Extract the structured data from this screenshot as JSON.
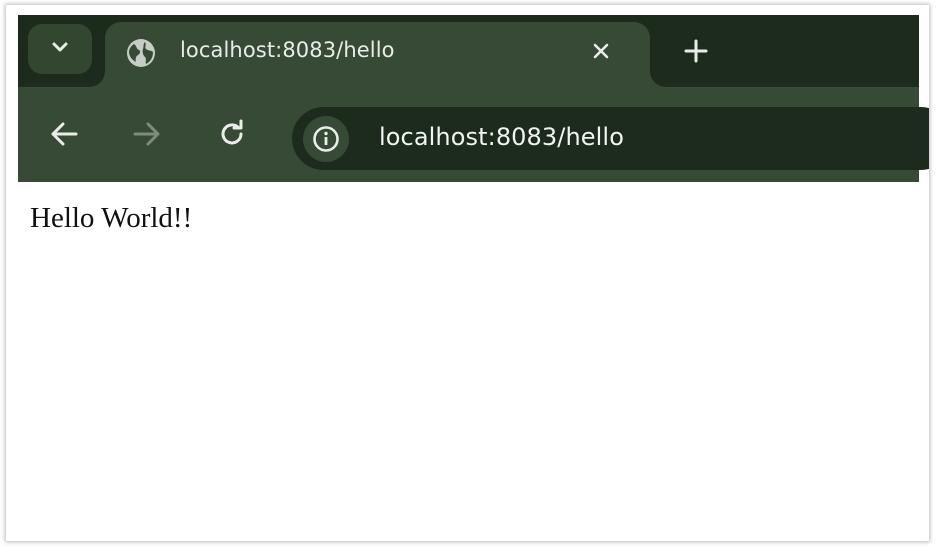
{
  "browser": {
    "tab": {
      "title": "localhost:8083/hello",
      "favicon": "globe-icon",
      "close_icon": "close-icon"
    },
    "tab_list_icon": "chevron-down-icon",
    "new_tab_icon": "plus-icon",
    "toolbar": {
      "back_icon": "arrow-left-icon",
      "forward_icon": "arrow-right-icon",
      "reload_icon": "reload-icon",
      "site_info_icon": "info-icon"
    },
    "address_bar": {
      "value": "localhost:8083/hello"
    },
    "colors": {
      "frame": "#1d2b1c",
      "toolbar": "#374a35",
      "text": "#e9ede8",
      "disabled_icon": "#7f8c7c"
    }
  },
  "page": {
    "body_text": "Hello World!!"
  }
}
